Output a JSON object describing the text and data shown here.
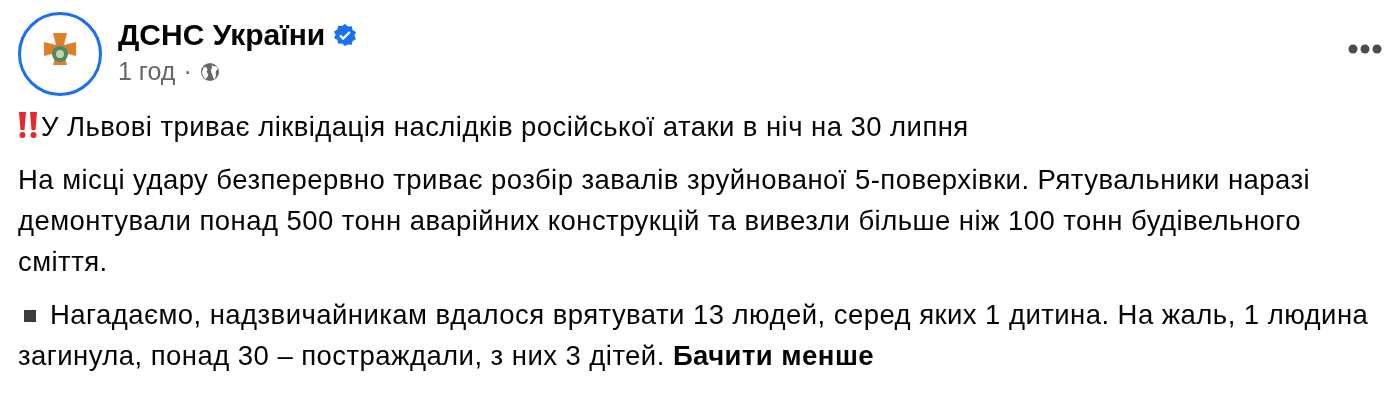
{
  "post": {
    "author": "ДСНС України",
    "verified": true,
    "time": "1 год",
    "separator": "·",
    "public_audience": true
  },
  "paragraphs": [
    {
      "kind": "alert",
      "text": "У Львові триває ліквідація наслідків російської атаки в ніч на 30 липня"
    },
    {
      "kind": "plain",
      "text": "На місці удару безперервно триває розбір завалів зруйнованої 5-поверхівки. Рятувальники наразі демонтували понад 500 тонн аварійних конструкцій та вивезли більше ніж 100 тонн будівельного сміття."
    },
    {
      "kind": "bullet",
      "text": "Нагадаємо, надзвичайникам вдалося врятувати 13 людей, серед яких 1 дитина. На жаль, 1 людина загинула, понад 30 – постраждали, з них 3 дітей.",
      "link": "Бачити менше"
    }
  ]
}
